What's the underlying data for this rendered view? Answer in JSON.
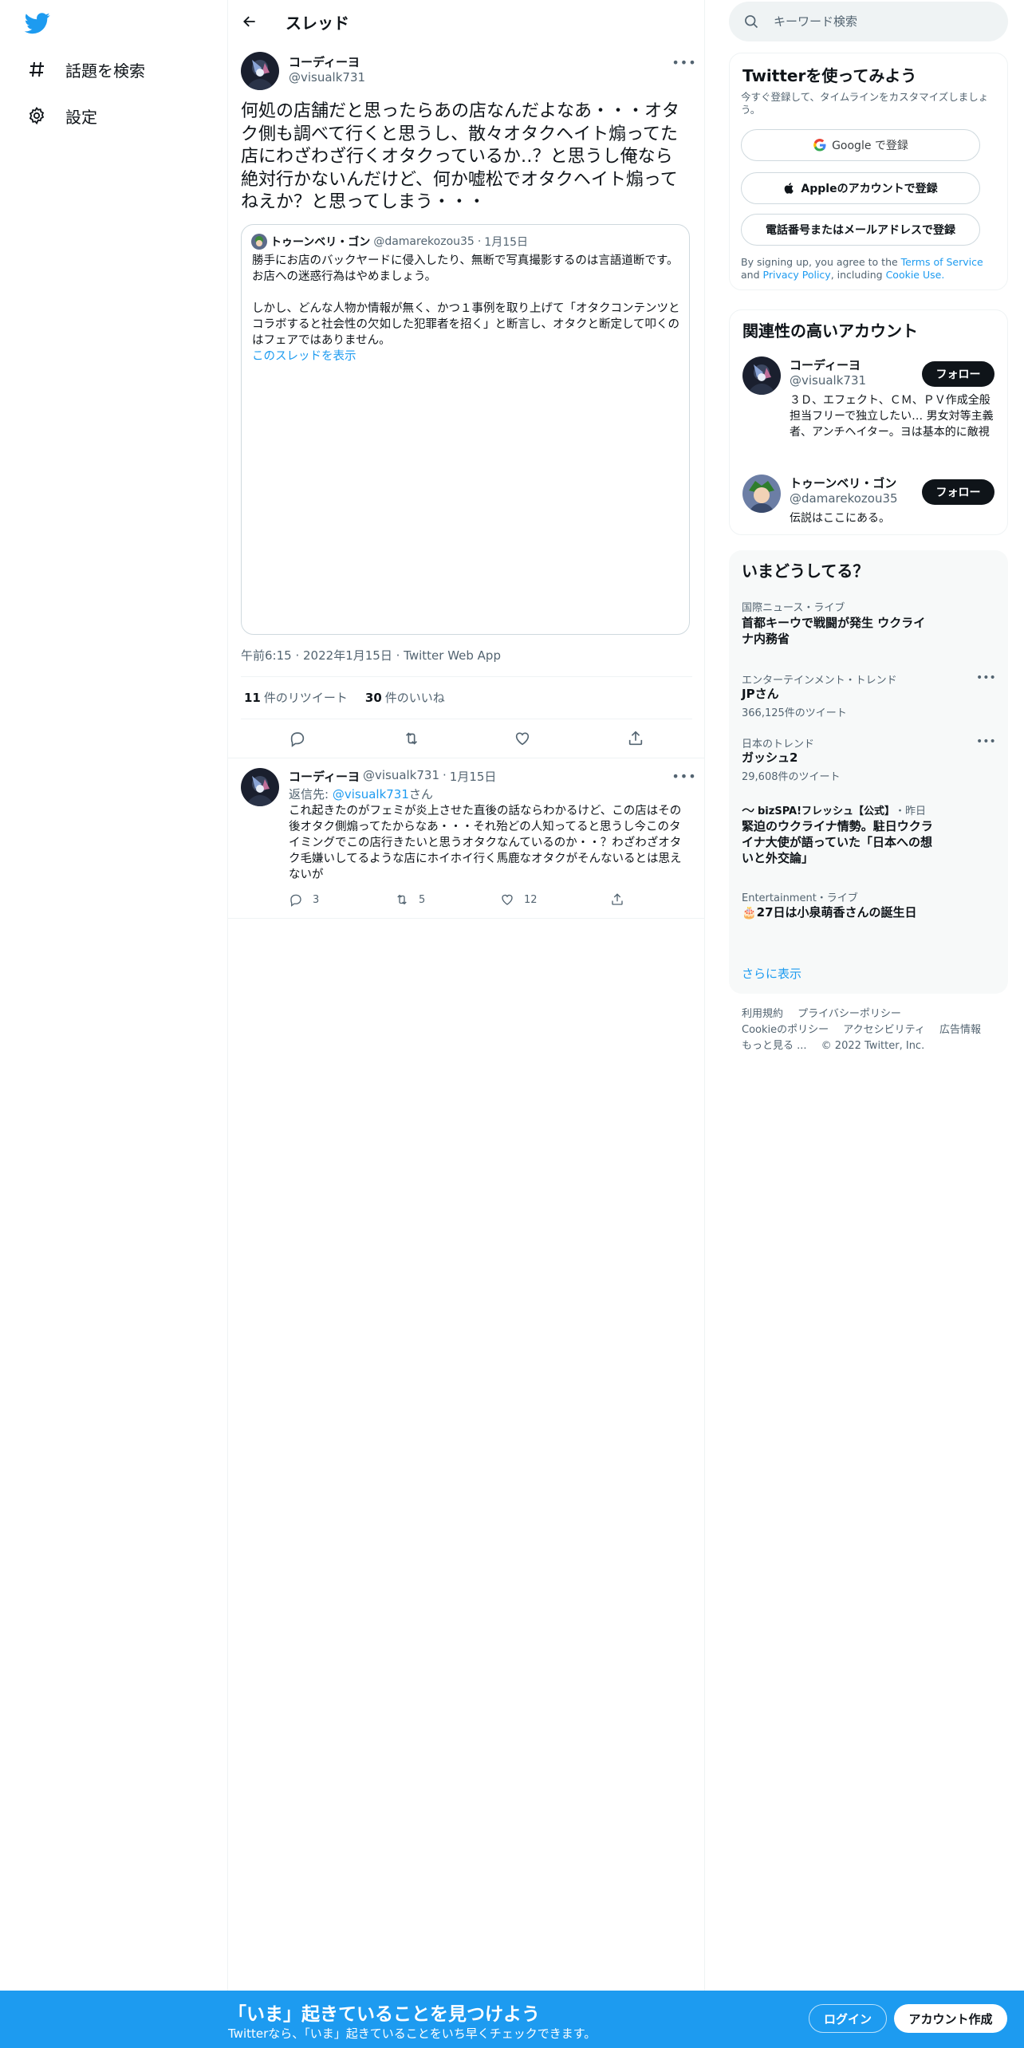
{
  "sidebar": {
    "items": [
      {
        "label": "話題を検索",
        "icon": "hashtag-icon"
      },
      {
        "label": "設定",
        "icon": "gear-icon"
      }
    ]
  },
  "header": {
    "title": "スレッド"
  },
  "tweet": {
    "author_name": "コーディーヨ",
    "author_handle": "@visualk731",
    "text": "何処の店舗だと思ったらあの店なんだよなあ・・・オタク側も調べて行くと思うし、散々オタクヘイト煽ってた店にわざわざ行くオタクっているか‥？と思うし俺なら絶対行かないんだけど、何か嘘松でオタクヘイト煽ってねえか？と思ってしまう・・・",
    "quote": {
      "author_name": "トゥーンベリ・ゴン",
      "author_handle": "@damarekozou35",
      "date": "1月15日",
      "para1": "勝手にお店のバックヤードに侵入したり、無断で写真撮影するのは言語道断です。お店への迷惑行為はやめましょう。",
      "para2": "しかし、どんな人物か情報が無く、かつ１事例を取り上げて「オタクコンテンツとコラボすると社会性の欠如した犯罪者を招く」と断言し、オタクと断定して叩くのはフェアではありません。",
      "show_thread": "このスレッドを表示"
    },
    "meta_time": "午前6:15",
    "meta_date": "2022年1月15日",
    "meta_source": "Twitter Web App",
    "retweets": "11",
    "retweets_label": "件のリツイート",
    "likes": "30",
    "likes_label": "件のいいね"
  },
  "reply": {
    "author_name": "コーディーヨ",
    "author_handle": "@visualk731",
    "date": "1月15日",
    "reply_to_label": "返信先:",
    "reply_to_handle": "@visualk731",
    "reply_to_suffix": "さん",
    "text": "これ起きたのがフェミが炎上させた直後の話ならわかるけど、この店はその後オタク側煽ってたからなあ・・・それ殆どの人知ってると思うし今このタイミングでこの店行きたいと思うオタクなんているのか・・？わざわざオタク毛嫌いしてるような店にホイホイ行く馬鹿なオタクがそんないるとは思えないが",
    "replies": "3",
    "retweets": "5",
    "likes": "12"
  },
  "search": {
    "placeholder": "キーワード検索"
  },
  "signup_card": {
    "title": "Twitterを使ってみよう",
    "subtitle": "今すぐ登録して、タイムラインをカスタマイズしましょう。",
    "google": "Google で登録",
    "apple": "Appleのアカウントで登録",
    "phone": "電話番号またはメールアドレスで登録",
    "terms_pre": "By signing up, you agree to the",
    "terms_link": "Terms of Service",
    "terms_and": "and",
    "privacy_link": "Privacy Policy",
    "terms_mid": ", including",
    "cookie_link": "Cookie Use."
  },
  "related": {
    "title": "関連性の高いアカウント",
    "accounts": [
      {
        "name": "コーディーヨ",
        "handle": "@visualk731",
        "bio": "３Ｄ、エフェクト、ＣＭ、ＰＶ作成全般担当フリーで独立したい… 男女対等主義者、アンチヘイター。ヨは基本的に敵視",
        "follow": "フォロー"
      },
      {
        "name": "トゥーンベリ・ゴン",
        "handle": "@damarekozou35",
        "bio": "伝説はここにある。",
        "follow": "フォロー"
      }
    ]
  },
  "trends": {
    "title": "いまどうしてる？",
    "items": [
      {
        "category": "国際ニュース・ライブ",
        "name": "首都キーウで戦闘が発生 ウクライナ内務省"
      },
      {
        "category": "エンターテインメント・トレンド",
        "name": "JPさん",
        "count": "366,125件のツイート"
      },
      {
        "category": "日本のトレンド",
        "name": "ガッシュ2",
        "count": "29,608件のツイート"
      },
      {
        "category": "bizSPA!フレッシュ【公式】",
        "category_suffix": "・昨日",
        "name": "緊迫のウクライナ情勢。駐日ウクライナ大使が語っていた「日本への想いと外交論」"
      },
      {
        "category": "Entertainment・ライブ",
        "name": "🎂27日は小泉萌香さんの誕生日"
      }
    ],
    "show_more": "さらに表示"
  },
  "footer": {
    "terms": "利用規約",
    "privacy": "プライバシーポリシー",
    "cookie": "Cookieのポリシー",
    "accessibility": "アクセシビリティ",
    "ads": "広告情報",
    "more": "もっと見る ...",
    "copyright": "© 2022 Twitter, Inc."
  },
  "banner": {
    "title": "「いま」起きていることを見つけよう",
    "subtitle": "Twitterなら、「いま」起きていることをいち早くチェックできます。",
    "login": "ログイン",
    "signup": "アカウント作成"
  },
  "colors": {
    "accent": "#1d9bf0",
    "text": "#0f1419",
    "muted": "#536471",
    "border": "#eff3f4"
  }
}
